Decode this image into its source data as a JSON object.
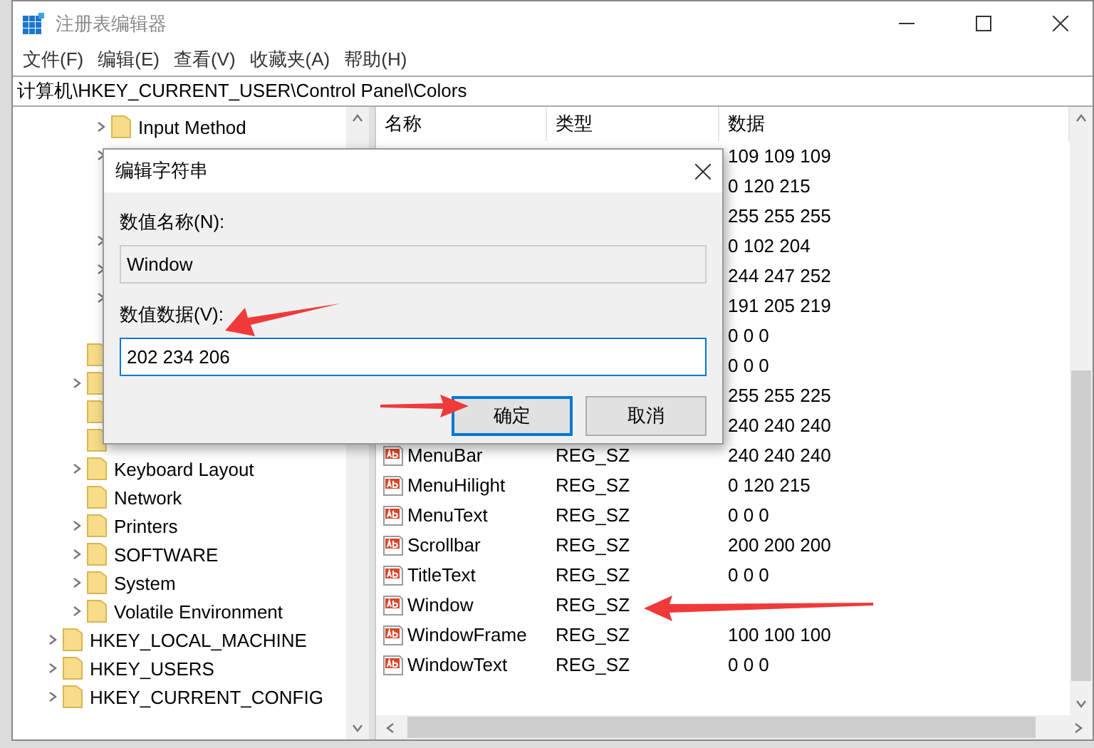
{
  "window": {
    "title": "注册表编辑器"
  },
  "menu": [
    "文件(F)",
    "编辑(E)",
    "查看(V)",
    "收藏夹(A)",
    "帮助(H)"
  ],
  "address": "计算机\\HKEY_CURRENT_USER\\Control Panel\\Colors",
  "tree": [
    {
      "children": [
        {
          "children": [
            {
              "label": "Input Method",
              "expandable": true
            },
            {
              "expandable": true
            },
            {
              "expandable": false
            },
            {
              "expandable": false
            },
            {
              "expandable": true
            },
            {
              "expandable": true
            },
            {
              "expandable": true
            },
            {
              "expandable": false
            }
          ]
        },
        {
          "expandable": false
        },
        {
          "expandable": true
        },
        {
          "expandable": false
        },
        {
          "expandable": false
        },
        {
          "label": "Keyboard Layout",
          "expandable": true
        },
        {
          "label": "Network",
          "expandable": false
        },
        {
          "label": "Printers",
          "expandable": true
        },
        {
          "label": "SOFTWARE",
          "expandable": true
        },
        {
          "label": "System",
          "expandable": true
        },
        {
          "label": "Volatile Environment",
          "expandable": true
        }
      ]
    },
    {
      "label": "HKEY_LOCAL_MACHINE",
      "expandable": true
    },
    {
      "label": "HKEY_USERS",
      "expandable": true
    },
    {
      "label": "HKEY_CURRENT_CONFIG",
      "expandable": true
    }
  ],
  "table": {
    "columns": [
      "名称",
      "类型",
      "数据"
    ],
    "rows": [
      {
        "data": "109 109 109"
      },
      {
        "data": "0 120 215"
      },
      {
        "data": "255 255 255"
      },
      {
        "data": "0 102 204"
      },
      {
        "data": "244 247 252"
      },
      {
        "data": "191 205 219"
      },
      {
        "data": "0 0 0"
      },
      {
        "data": "0 0 0"
      },
      {
        "data": "255 255 225"
      },
      {
        "data": "240 240 240"
      },
      {
        "name": "MenuBar",
        "type": "REG_SZ",
        "data": "240 240 240"
      },
      {
        "name": "MenuHilight",
        "type": "REG_SZ",
        "data": "0 120 215"
      },
      {
        "name": "MenuText",
        "type": "REG_SZ",
        "data": "0 0 0"
      },
      {
        "name": "Scrollbar",
        "type": "REG_SZ",
        "data": "200 200 200"
      },
      {
        "name": "TitleText",
        "type": "REG_SZ",
        "data": "0 0 0"
      },
      {
        "name": "Window",
        "type": "REG_SZ"
      },
      {
        "name": "WindowFrame",
        "type": "REG_SZ",
        "data": "100 100 100"
      },
      {
        "name": "WindowText",
        "type": "REG_SZ",
        "data": "0 0 0"
      }
    ]
  },
  "dialog": {
    "title": "编辑字符串",
    "name_label": "数值名称(N):",
    "name_value": "Window",
    "data_label": "数值数据(V):",
    "data_value": "202 234 206",
    "buttons": [
      {
        "label": "确定",
        "focused": true
      },
      {
        "label": "取消",
        "focused": false
      }
    ]
  }
}
